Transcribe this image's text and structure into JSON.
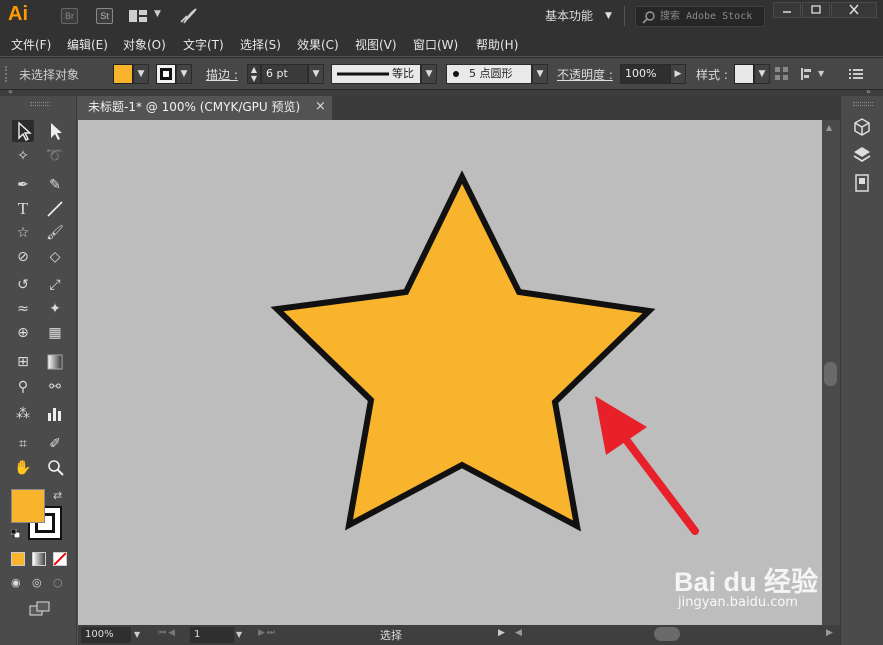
{
  "titlebar": {
    "app_logo": "Ai",
    "bridge_badge": "Br",
    "stock_badge": "St",
    "workspace_label": "基本功能",
    "search_placeholder": "搜索 Adobe Stock"
  },
  "menubar": {
    "items": [
      "文件(F)",
      "编辑(E)",
      "对象(O)",
      "文字(T)",
      "选择(S)",
      "效果(C)",
      "视图(V)",
      "窗口(W)",
      "帮助(H)"
    ]
  },
  "controlbar": {
    "selection_status": "未选择对象",
    "stroke_label": "描边 :",
    "stroke_weight": "6 pt",
    "profile_label": "等比",
    "brush_label": "5 点圆形",
    "opacity_label": "不透明度 :",
    "opacity_value": "100%",
    "style_label": "样式 :"
  },
  "document": {
    "tab_title": "未标题-1* @ 100% (CMYK/GPU 预览)",
    "close_glyph": "×"
  },
  "statusbar": {
    "zoom": "100%",
    "artboard_number": "1",
    "tool_status": "选择"
  },
  "watermark": {
    "brand": "Bai du 经验",
    "url": "jingyan.baidu.com"
  },
  "colors": {
    "fill": "#f8b42c",
    "stroke": "#111111",
    "arrow": "#e8202a",
    "canvas": "#bcbdbc",
    "app_logo": "#ff9a00"
  }
}
